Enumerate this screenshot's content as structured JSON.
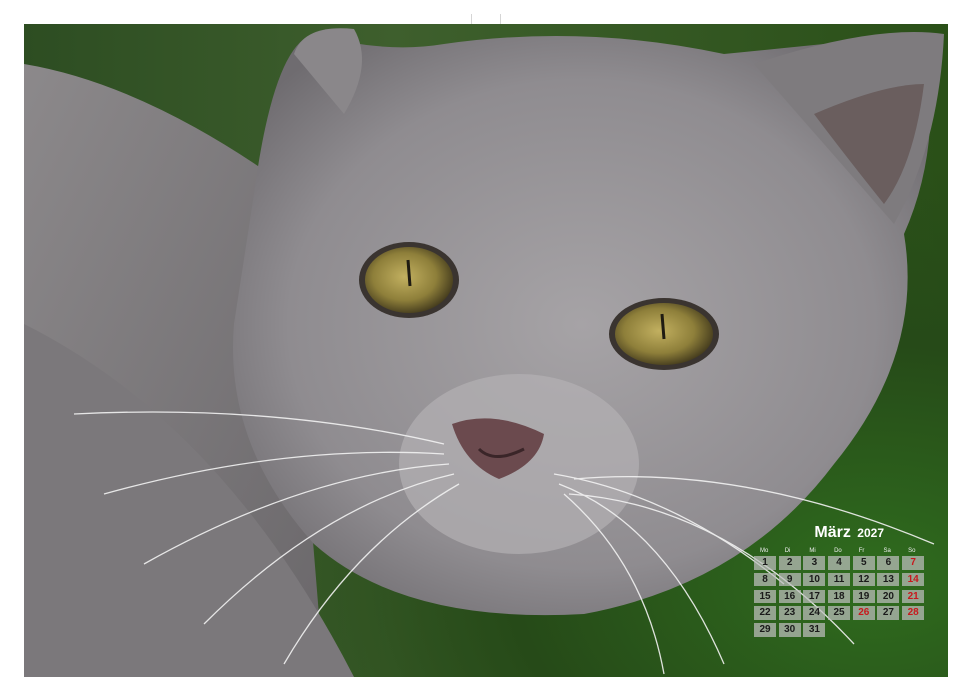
{
  "page": {
    "binding": "wire-o"
  },
  "calendar": {
    "month": "März",
    "year": "2027",
    "weekdays": [
      "Mo",
      "Di",
      "Mi",
      "Do",
      "Fr",
      "Sa",
      "So"
    ],
    "weeks": [
      [
        "1",
        "2",
        "3",
        "4",
        "5",
        "6",
        "7"
      ],
      [
        "8",
        "9",
        "10",
        "11",
        "12",
        "13",
        "14"
      ],
      [
        "15",
        "16",
        "17",
        "18",
        "19",
        "20",
        "21"
      ],
      [
        "22",
        "23",
        "24",
        "25",
        "26",
        "27",
        "28"
      ],
      [
        "29",
        "30",
        "31",
        "",
        "",
        "",
        ""
      ]
    ],
    "holidays": [
      "26"
    ],
    "colors": {
      "weekday": "#1a1a1a",
      "sunday": "#c8181c",
      "cell": "#bebebe",
      "header": "#ffffff"
    }
  }
}
